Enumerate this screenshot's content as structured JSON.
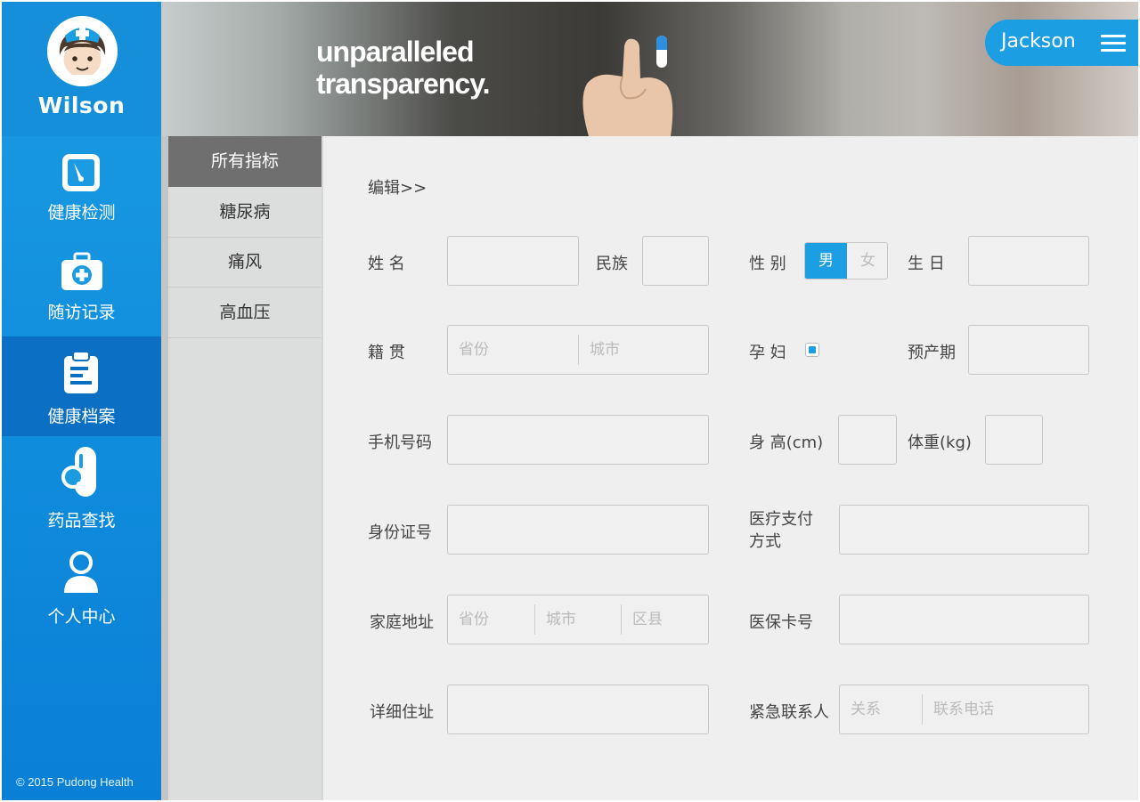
{
  "brand": {
    "name": "Wilson"
  },
  "nav": {
    "items": [
      {
        "label": "健康检测",
        "icon": "gauge-icon"
      },
      {
        "label": "随访记录",
        "icon": "medical-kit-icon"
      },
      {
        "label": "健康档案",
        "icon": "clipboard-icon"
      },
      {
        "label": "药品查找",
        "icon": "pill-search-icon"
      },
      {
        "label": "个人中心",
        "icon": "user-icon"
      }
    ]
  },
  "footer": {
    "copyright": "© 2015 Pudong Health"
  },
  "banner": {
    "line1": "unparalleled",
    "line2": "transparency."
  },
  "user": {
    "name": "Jackson"
  },
  "submenu": {
    "items": [
      "所有指标",
      "糖尿病",
      "痛风",
      "高血压"
    ]
  },
  "form": {
    "edit_link": "编辑>>",
    "labels": {
      "name": "姓  名",
      "ethnicity": "民族",
      "gender": "性  别",
      "birthday": "生  日",
      "native_place": "籍  贯",
      "pregnant": "孕  妇",
      "due_date": "预产期",
      "phone": "手机号码",
      "height": "身  高(cm)",
      "weight": "体重(kg)",
      "id_number": "身份证号",
      "payment_line1": "医疗支付",
      "payment_line2": "方式",
      "home_address": "家庭地址",
      "insurance_card": "医保卡号",
      "detail_address": "详细住址",
      "emergency_contact": "紧急联系人"
    },
    "gender_options": {
      "male": "男",
      "female": "女"
    },
    "placeholders": {
      "province": "省份",
      "city": "城市",
      "district": "区县",
      "relation": "关系",
      "contact_phone": "联系电话"
    }
  }
}
